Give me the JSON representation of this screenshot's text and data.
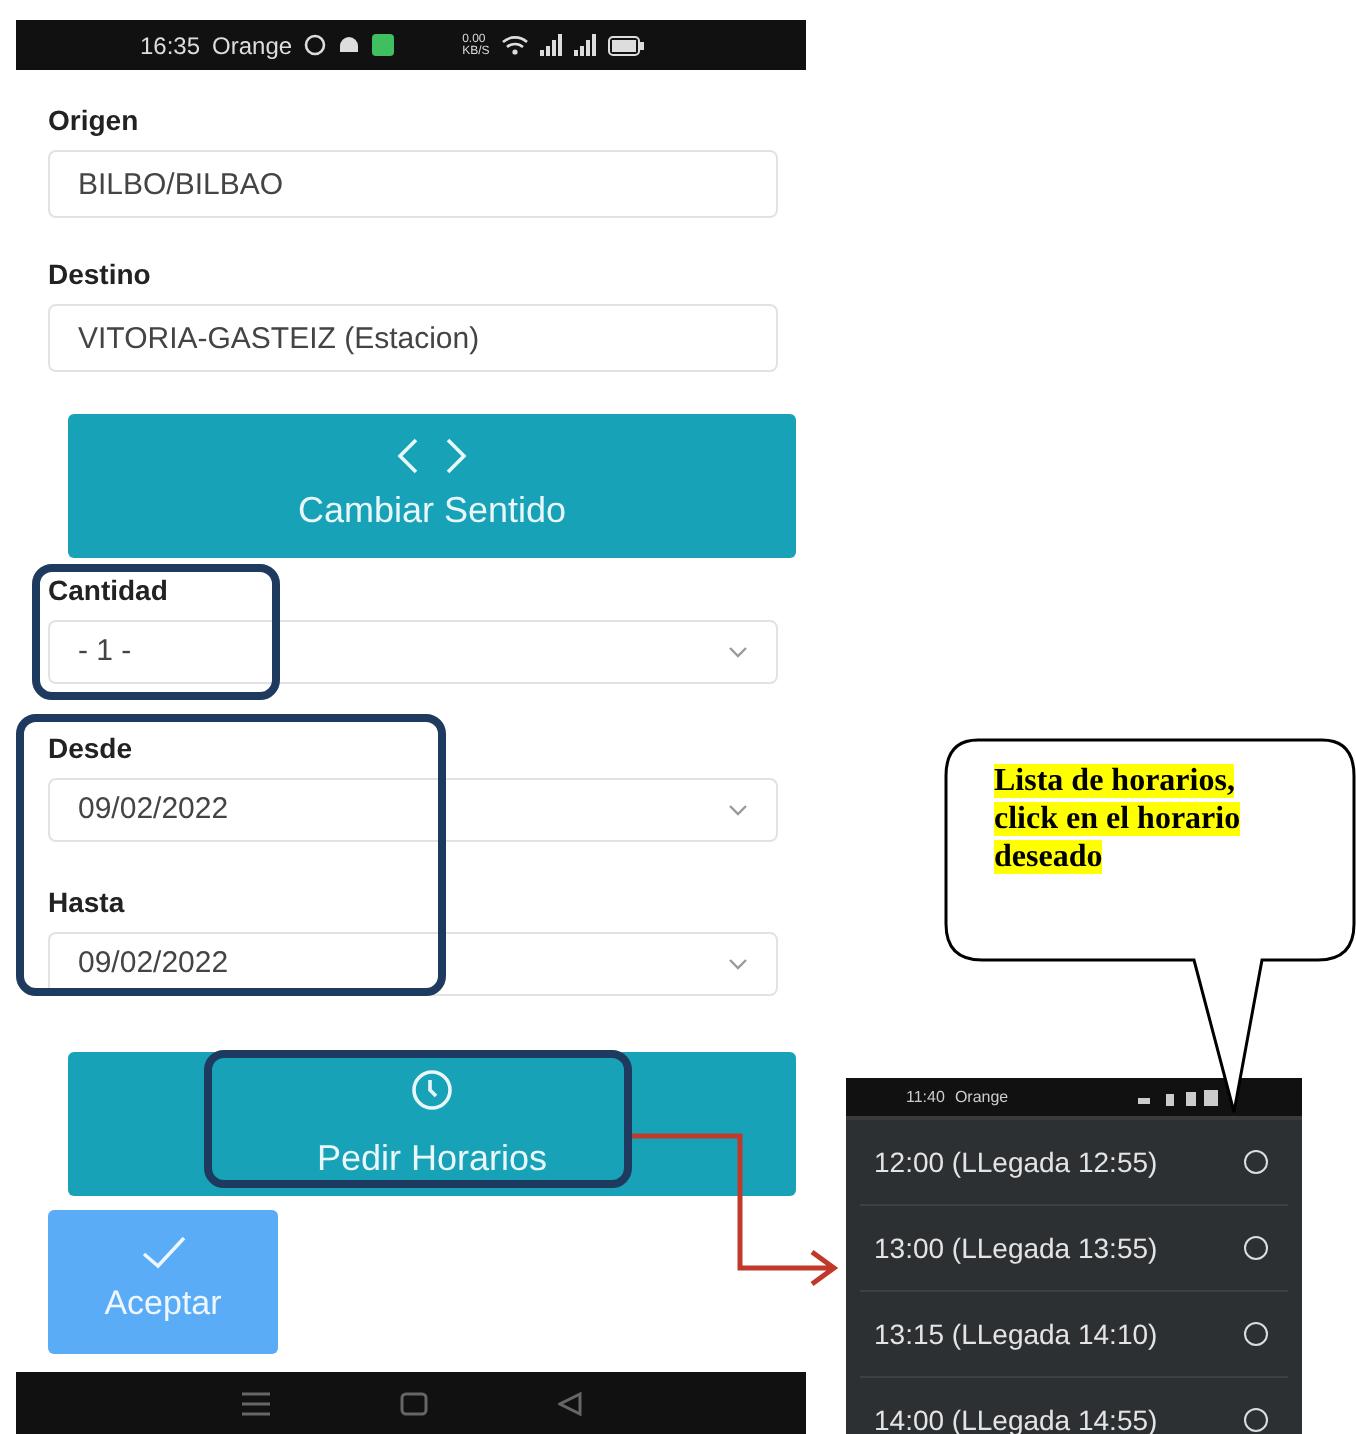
{
  "main_screen": {
    "status_bar": {
      "time": "16:35",
      "carrier": "Orange",
      "speed": "0.00",
      "speed_unit": "KB/S"
    },
    "fields": [
      {
        "label": "Origen",
        "value": "BILBO/BILBAO"
      },
      {
        "label": "Destino",
        "value": "VITORIA-GASTEIZ (Estacion)"
      }
    ],
    "swap_button": {
      "label": "Cambiar Sentido"
    },
    "selects": [
      {
        "label": "Cantidad",
        "value": "- 1 -"
      },
      {
        "label": "Desde",
        "value": "09/02/2022"
      },
      {
        "label": "Hasta",
        "value": "09/02/2022"
      }
    ],
    "schedule_button": {
      "label": "Pedir Horarios"
    },
    "accept_button": {
      "label": "Aceptar"
    }
  },
  "callout": {
    "text": "Lista de horarios, click en el horario deseado"
  },
  "schedule_screen": {
    "status_bar": {
      "time": "11:40",
      "carrier": "Orange"
    },
    "options": [
      {
        "label": "12:00 (LLegada 12:55)",
        "selected": false
      },
      {
        "label": "13:00 (LLegada 13:55)",
        "selected": false
      },
      {
        "label": "13:15 (LLegada 14:10)",
        "selected": false
      },
      {
        "label": "14:00 (LLegada 14:55)",
        "selected": false
      }
    ]
  }
}
